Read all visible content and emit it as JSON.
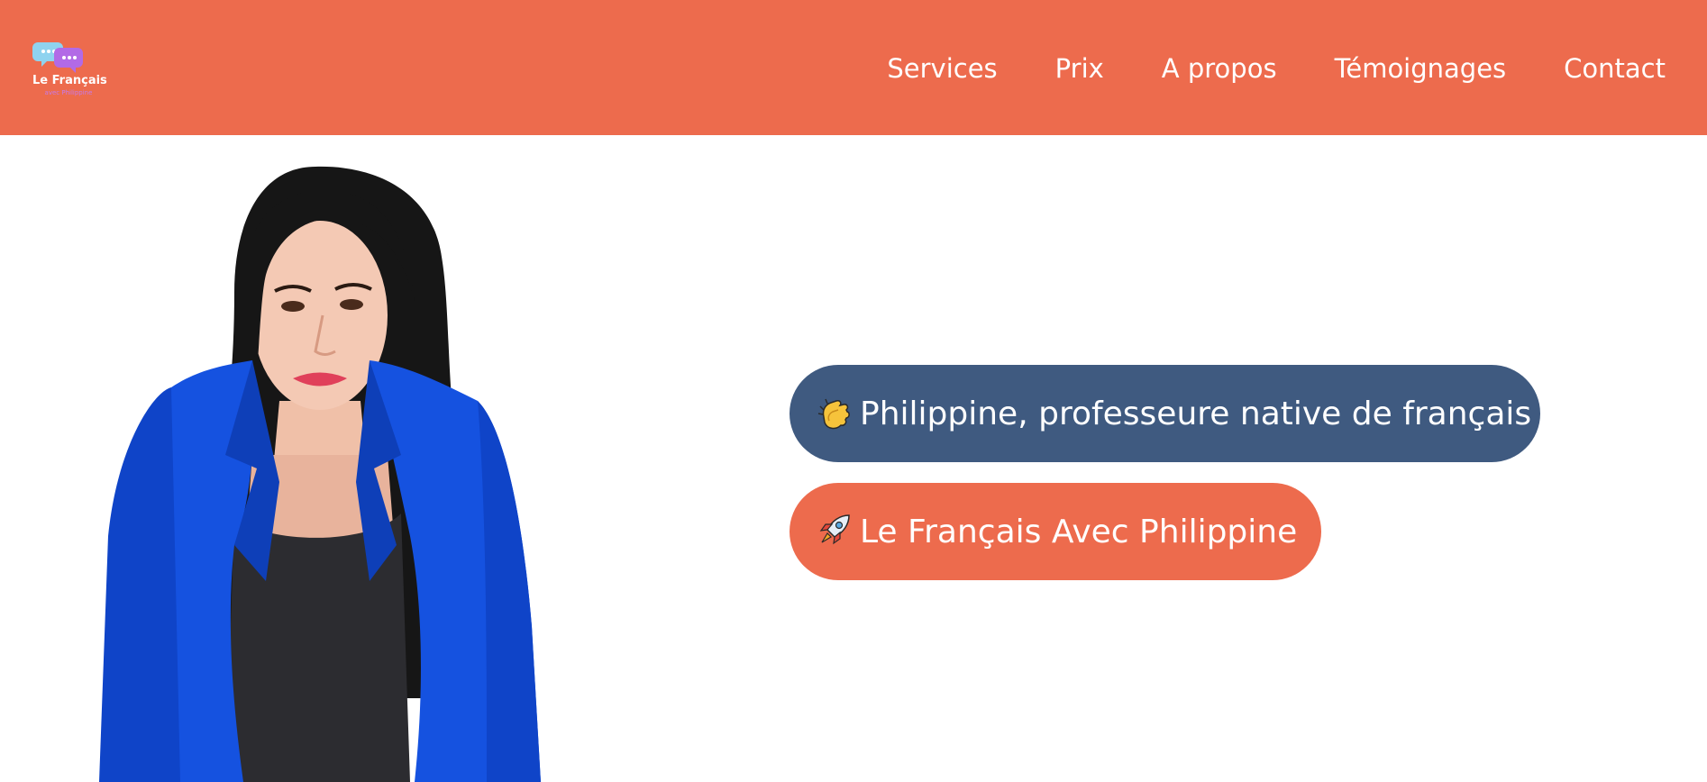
{
  "header": {
    "logo": {
      "title": "Le Français",
      "subtitle": "avec Philippine",
      "icon": "chat-bubbles-icon"
    },
    "nav": [
      {
        "label": "Services"
      },
      {
        "label": "Prix"
      },
      {
        "label": "A propos"
      },
      {
        "label": "Témoignages"
      },
      {
        "label": "Contact"
      }
    ],
    "background_color": "#ed6b4d"
  },
  "hero": {
    "intro_pill": {
      "icon": "clapping-hands-icon",
      "text": "Philippine, professeure native de français",
      "color": "#3f5a80"
    },
    "brand_pill": {
      "icon": "rocket-icon",
      "text": "Le Français Avec Philippine",
      "color": "#ed6b4d"
    },
    "portrait": "portrait-photo"
  }
}
